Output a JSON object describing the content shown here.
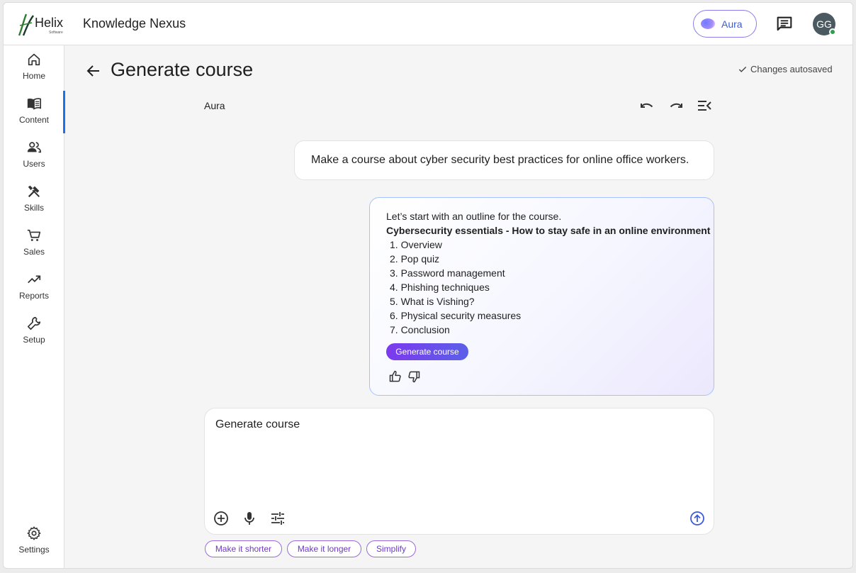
{
  "header": {
    "logo_text": "Helix",
    "logo_subtext": "Software",
    "app_title": "Knowledge Nexus",
    "aura_label": "Aura",
    "avatar_initials": "GG"
  },
  "sidebar": {
    "items": [
      {
        "label": "Home",
        "icon": "home-icon"
      },
      {
        "label": "Content",
        "icon": "book-icon",
        "active": true
      },
      {
        "label": "Users",
        "icon": "users-icon"
      },
      {
        "label": "Skills",
        "icon": "tools-icon"
      },
      {
        "label": "Sales",
        "icon": "cart-icon"
      },
      {
        "label": "Reports",
        "icon": "trending-up-icon"
      },
      {
        "label": "Setup",
        "icon": "wrench-icon"
      }
    ],
    "settings_label": "Settings"
  },
  "page": {
    "title": "Generate course",
    "autosave_status": "Changes autosaved"
  },
  "chat": {
    "panel_title": "Aura",
    "user_message": "Make a course about cyber security best practices for online office workers.",
    "ai_intro": "Let’s start with an outline for the course.",
    "ai_outline_title": "Cybersecurity essentials - How to stay safe in an online environment",
    "ai_outline_items": [
      "1. Overview",
      "2. Pop quiz",
      "3. Password management",
      "4. Phishing techniques",
      "5. What is Vishing?",
      "6. Physical security measures",
      "7. Conclusion"
    ],
    "generate_button_label": "Generate course"
  },
  "composer": {
    "value": "Generate course"
  },
  "suggestions": [
    "Make it shorter",
    "Make it longer",
    "Simplify"
  ],
  "colors": {
    "accent_blue": "#1a73e8",
    "aura_purple": "#7c3aed",
    "online_green": "#2e9e4f"
  }
}
